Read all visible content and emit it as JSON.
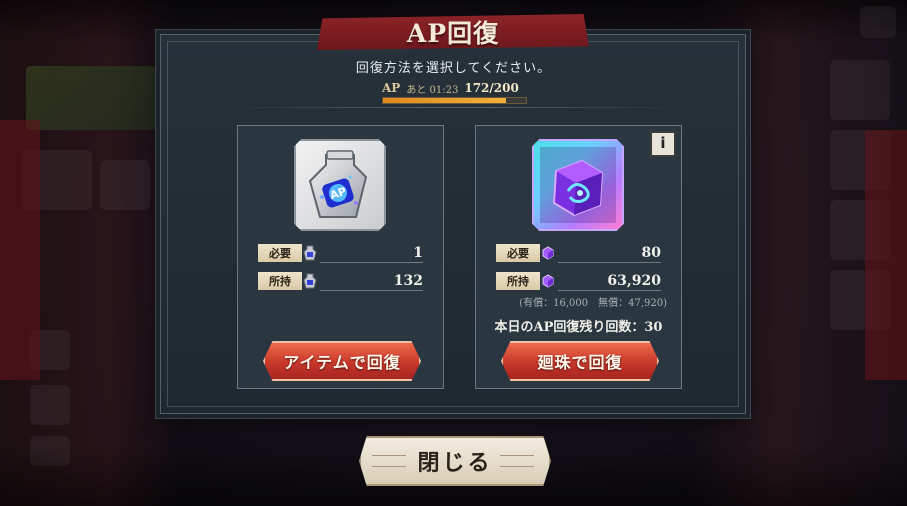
{
  "dialog": {
    "title": "AP回復",
    "subtitle": "回復方法を選択してください。",
    "ap": {
      "label": "AP",
      "timer": "あと 01:23",
      "value": "172/200",
      "fraction": 0.86
    }
  },
  "item_option": {
    "required_label": "必要",
    "required_value": "1",
    "owned_label": "所持",
    "owned_value": "132",
    "icon": "ap-potion-icon",
    "button_label": "アイテムで回復"
  },
  "stone_option": {
    "required_label": "必要",
    "required_value": "80",
    "owned_label": "所持",
    "owned_value": "63,920",
    "breakdown": "(有償：16,000　無償：47,920)",
    "remaining": "本日のAP回復残り回数：30",
    "icon": "spirit-cube-icon",
    "info_label": "i",
    "button_label": "廻珠で回復"
  },
  "close_label": "閉じる",
  "colors": {
    "accent_red": "#c8382a",
    "ap_bar": "#e08a1c",
    "title_banner": "#8d2428"
  }
}
